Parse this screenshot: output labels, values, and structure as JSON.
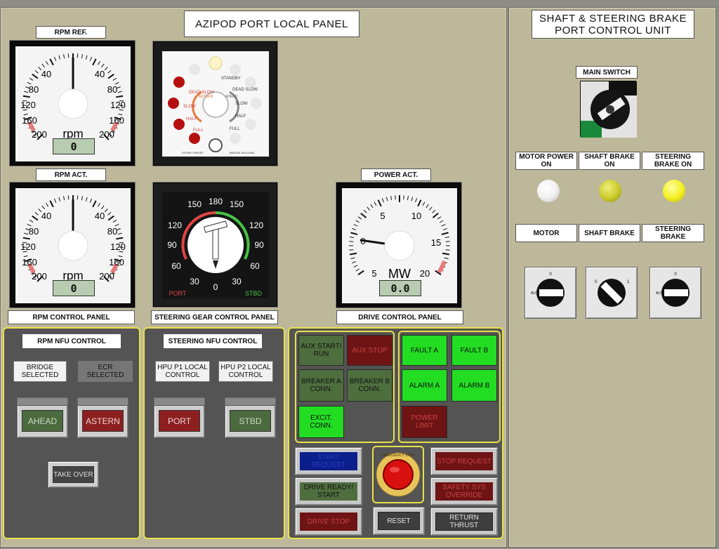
{
  "main_title": "AZIPOD PORT  LOCAL PANEL",
  "brake_title_line1": "SHAFT & STEERING BRAKE",
  "brake_title_line2": "PORT CONTROL UNIT",
  "gauges": {
    "rpm_ref": {
      "label": "RPM REF.",
      "unit": "rpm",
      "display": "0",
      "ticks_left": [
        "40",
        "80",
        "120",
        "160",
        "200"
      ],
      "ticks_right": [
        "40",
        "80",
        "120",
        "160",
        "200"
      ],
      "value": 0
    },
    "rpm_act": {
      "label": "RPM ACT.",
      "unit": "rpm",
      "display": "0",
      "ticks_left": [
        "40",
        "80",
        "120",
        "160",
        "200"
      ],
      "ticks_right": [
        "40",
        "80",
        "120",
        "160",
        "200"
      ],
      "value": 0
    },
    "power_act": {
      "label": "POWER ACT.",
      "unit": "MW",
      "display": "0.0",
      "ticks": [
        "0",
        "5",
        "10",
        "15",
        "20",
        "5"
      ],
      "value": 0
    }
  },
  "telegraph": {
    "left_labels": [
      "DEAD SLOW",
      "SLOW",
      "HALF",
      "FULL"
    ],
    "right_labels": [
      "STANDBY",
      "DEAD SLOW",
      "SLOW",
      "HALF",
      "FULL"
    ],
    "ring_left": "ASTERN",
    "ring_right": "AHEAD",
    "footer_left": "STERN THRUST",
    "footer_right": "BRIDGE HOLLAND"
  },
  "steering": {
    "scale": [
      "150",
      "180",
      "150",
      "120",
      "90",
      "60",
      "30",
      "0",
      "30",
      "60",
      "90",
      "120"
    ],
    "port_label": "PORT",
    "stbd_label": "STBD"
  },
  "section_labels": {
    "rpm_control": "RPM CONTROL PANEL",
    "steering_control": "STEERING GEAR CONTROL PANEL",
    "drive_control": "DRIVE CONTROL PANEL"
  },
  "rpm_nfu": {
    "title": "RPM  NFU CONTROL",
    "bridge_selected": "BRIDGE SELECTED",
    "ecr_selected": "ECR SELECTED",
    "ahead": "AHEAD",
    "astern": "ASTERN",
    "take_over": "TAKE OVER"
  },
  "steering_nfu": {
    "title": "STEERING NFU CONTROL",
    "hpu_p1": "HPU P1 LOCAL CONTROL",
    "hpu_p2": "HPU P2 LOCAL CONTROL",
    "port": "PORT",
    "stbd": "STBD"
  },
  "drive": {
    "aux_start": "AUX START/ RUN",
    "aux_stop": "AUX STOP",
    "breaker_a": "BREAKER A CONN.",
    "breaker_b": "BREAKER B CONN.",
    "excit_conn": "EXCIT. CONN.",
    "fault_a": "FAULT A",
    "fault_b": "FAULT B",
    "alarm_a": "ALARM A",
    "alarm_b": "ALARM B",
    "power_limit": "POWER LIMIT",
    "start_request": "START REQUEST",
    "drive_ready": "DRIVE READY/ START",
    "drive_stop": "DRIVE STOP",
    "emergency_stop": "EMERGENCY STOP",
    "reset": "RESET",
    "stop_request": "STOP REQUEST",
    "safety_override": "SAFETY SYS OVERRIDE",
    "return_thrust": "RETURN THRUST"
  },
  "brake_panel": {
    "main_switch": "MAIN SWITCH",
    "indicators": [
      {
        "label": "MOTOR POWER ON",
        "color": "#f2f2f2"
      },
      {
        "label": "SHAFT BRAKE ON",
        "color": "#c9c92a"
      },
      {
        "label": "STEERING BRAKE ON",
        "color": "#f3ef20"
      }
    ],
    "switches": [
      {
        "label": "MOTOR",
        "left_mark": "AUT",
        "top_mark": "0"
      },
      {
        "label": "SHAFT BRAKE",
        "left_mark": "0",
        "top_mark": "1"
      },
      {
        "label": "STEERING BRAKE",
        "left_mark": "AUT",
        "top_mark": "0"
      }
    ]
  },
  "colors": {
    "panel": "#bdb89a",
    "section_border": "#e8e14a",
    "green_lamp": "#22dd22",
    "red_lamp": "#6e1414"
  }
}
